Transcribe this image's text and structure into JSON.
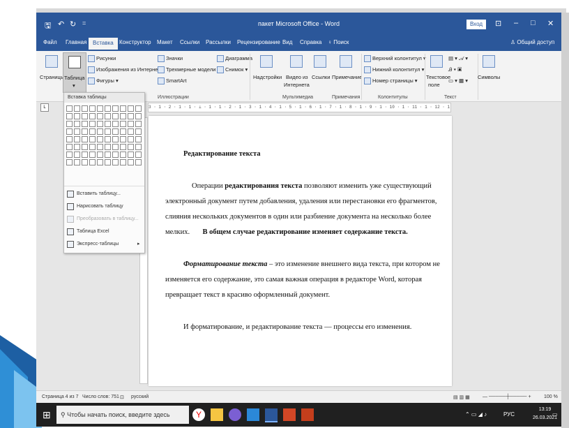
{
  "title_bar": {
    "doc_title": "пакет Microsoft Office - Word",
    "signin": "Вход",
    "qa_save": "🖫",
    "qa_undo": "↶",
    "qa_redo": "↻",
    "qa_more": "=",
    "ribbon_options": "⊡",
    "minimize": "–",
    "restore": "□",
    "close": "✕"
  },
  "tabs": [
    {
      "label": "Файл"
    },
    {
      "label": "Главная"
    },
    {
      "label": "Вставка",
      "active": true
    },
    {
      "label": "Конструктор"
    },
    {
      "label": "Макет"
    },
    {
      "label": "Ссылки"
    },
    {
      "label": "Рассылки"
    },
    {
      "label": "Рецензирование"
    },
    {
      "label": "Вид"
    },
    {
      "label": "Справка"
    },
    {
      "label": "Поиск"
    }
  ],
  "share_label": "Общий доступ",
  "ribbon": {
    "pages": "Страницы",
    "table": "Таблица",
    "pictures": "Рисунки",
    "online_pictures": "Изображения из Интернета",
    "shapes": "Фигуры",
    "icons": "Значки",
    "models3d": "Трехмерные модели",
    "smartart": "SmartArt",
    "chart": "Диаграмма",
    "screenshot": "Снимок",
    "addins": "Надстройки",
    "online_video_1": "Видео из",
    "online_video_2": "Интернета",
    "links": "Ссылки",
    "comment": "Примечание",
    "header": "Верхний колонтитул",
    "footer": "Нижний колонтитул",
    "page_number": "Номер страницы",
    "textbox_1": "Текстовое",
    "textbox_2": "поле",
    "symbols": "Символы",
    "groups": {
      "illustrations": "Иллюстрации",
      "media": "Мультимедиа",
      "comments": "Примечания",
      "header_footer": "Колонтитулы",
      "text": "Текст"
    }
  },
  "ruler_text": "3 · 1 · 2 · 1 · 1 · ⊥ · 1 · 1 · 2 · 1 · 3 · 1 · 4 · 1 · 5 · 1 · 6 · 1 · 7 · 1 · 8 · 1 · 9 · 1 · 10 · 1 · 11 · 1 · 12 · 1 · 13 · 1 · 14 · 1 · 15 · 1 · 16 · 1 · 17 · 1 · 18 · △ 19 ·",
  "dropdown": {
    "header": "Вставка таблицы",
    "items": [
      {
        "label": "Вставить таблицу..."
      },
      {
        "label": "Нарисовать таблицу"
      },
      {
        "label": "Преобразовать в таблицу...",
        "disabled": true
      },
      {
        "label": "Таблица Excel"
      },
      {
        "label": "Экспресс-таблицы",
        "submenu": true
      }
    ]
  },
  "document": {
    "heading": "Редактирование текста",
    "p1_l1_a": "Операции ",
    "p1_l1_b": "редактирования текста",
    "p1_l1_c": " позволяют изменить уже существующий",
    "p1_l2": "электронный документ путем добавления, удаления или перестановки его фрагментов,",
    "p1_l3": "слияния нескольких документов в один или разбиение документа на несколько более",
    "p1_l4_a": "мелких.",
    "p1_l4_b": "В общем случае редактирование изменяет содержание текста.",
    "p2_l1_a": "Форматирование текста",
    "p2_l1_b": " – это изменение внешнего вида текста, при котором не",
    "p2_l2": "изменяется его содержание, это самая важная операция в редакторе Word, которая",
    "p2_l3": "превращает текст в красиво оформленный документ.",
    "p3": "И форматирование, и редактирование текста — процессы его изменения."
  },
  "status": {
    "page": "Страница 4 из 7",
    "words": "Число слов: 751",
    "language": "русский",
    "zoom": "100 %"
  },
  "taskbar": {
    "search_placeholder": "Чтобы начать поиск, введите здесь запрос",
    "lang": "РУС",
    "time": "13:19",
    "date": "26.03.2021"
  },
  "colors": {
    "word_blue": "#2b579a",
    "taskbar": "#202020",
    "accent_left": "#1f6fb5"
  }
}
